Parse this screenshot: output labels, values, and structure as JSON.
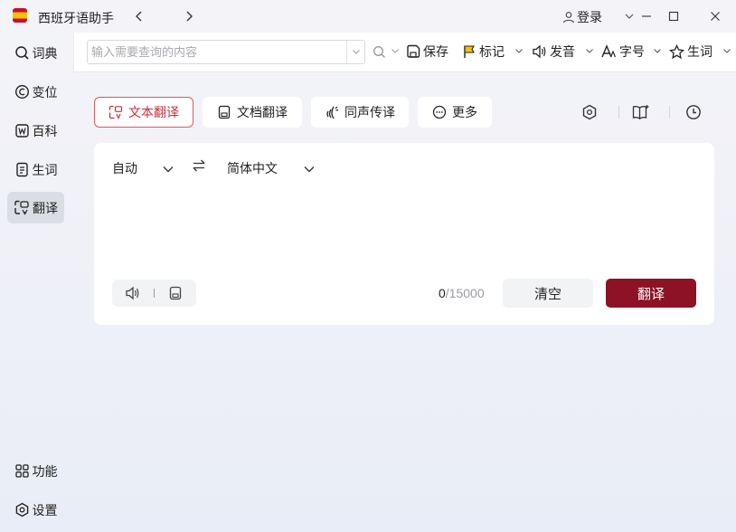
{
  "window": {
    "title": "西班牙语助手",
    "login_label": "登录"
  },
  "sidebar": {
    "items": [
      {
        "label": "词典",
        "icon": "search-icon"
      },
      {
        "label": "变位",
        "icon": "conjugation-icon"
      },
      {
        "label": "百科",
        "icon": "wiki-icon"
      },
      {
        "label": "生词",
        "icon": "vocab-notebook-icon"
      },
      {
        "label": "翻译",
        "icon": "translate-icon",
        "active": true
      }
    ],
    "bottom": [
      {
        "label": "功能",
        "icon": "grid-icon"
      },
      {
        "label": "设置",
        "icon": "settings-icon"
      }
    ]
  },
  "toolbar": {
    "search_placeholder": "输入需要查询的内容",
    "search_value": "",
    "buttons": [
      {
        "label": "保存",
        "icon": "save-icon"
      },
      {
        "label": "标记",
        "icon": "flag-icon"
      },
      {
        "label": "发音",
        "icon": "speaker-icon"
      },
      {
        "label": "字号",
        "icon": "font-size-icon"
      },
      {
        "label": "生词",
        "icon": "star-icon"
      }
    ]
  },
  "modes": [
    {
      "label": "文本翻译",
      "icon": "text-translate-icon",
      "active": true
    },
    {
      "label": "文档翻译",
      "icon": "document-icon"
    },
    {
      "label": "同声传译",
      "icon": "live-interpret-icon"
    },
    {
      "label": "更多",
      "icon": "more-icon"
    }
  ],
  "translator": {
    "source_lang": "自动",
    "target_lang": "简体中文",
    "input_text": "",
    "count_current": "0",
    "count_max": "/15000",
    "clear_label": "清空",
    "translate_label": "翻译"
  },
  "colors": {
    "accent": "#8d1225",
    "active_tab_border": "#e0565f",
    "active_sidebar_bg": "#dadde3"
  }
}
